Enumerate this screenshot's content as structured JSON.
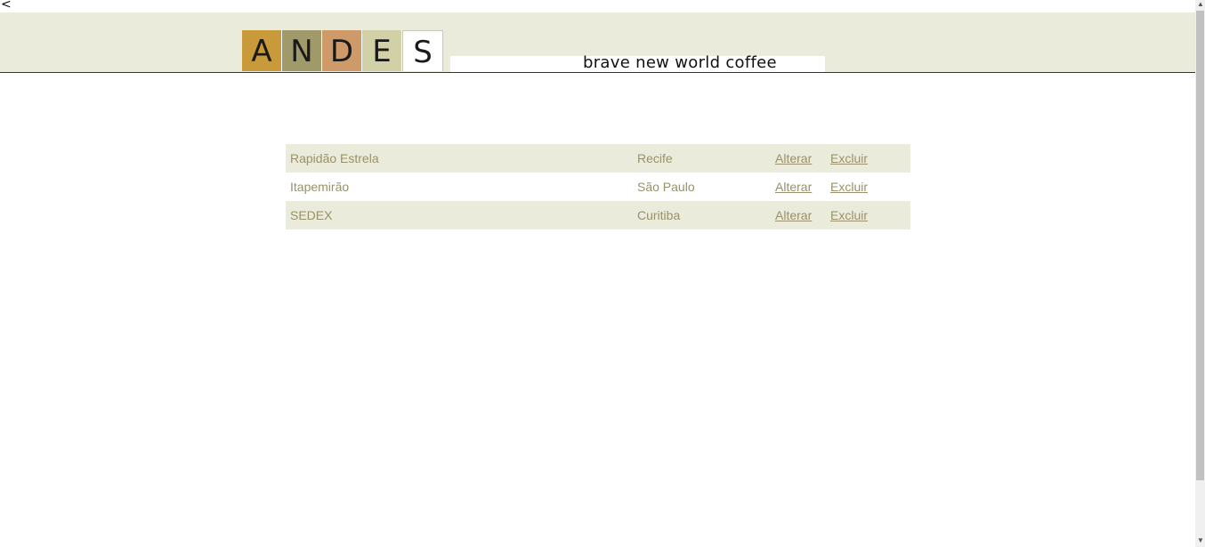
{
  "stray_text": "<",
  "logo": {
    "letters": [
      "A",
      "N",
      "D",
      "E",
      "S"
    ],
    "colors": [
      "#c89a3a",
      "#a09a6a",
      "#cf9a6a",
      "#d2d0a6",
      "#ffffff"
    ]
  },
  "tagline": "brave new world coffee",
  "colors": {
    "band": "#ebebdb",
    "text": "#98916a"
  },
  "rows": [
    {
      "name": "Rapidão Estrela",
      "city": "Recife",
      "alter": "Alterar",
      "delete": "Excluir"
    },
    {
      "name": "Itapemirão",
      "city": "São Paulo",
      "alter": "Alterar",
      "delete": "Excluir"
    },
    {
      "name": "SEDEX",
      "city": "Curitiba",
      "alter": "Alterar",
      "delete": "Excluir"
    }
  ]
}
